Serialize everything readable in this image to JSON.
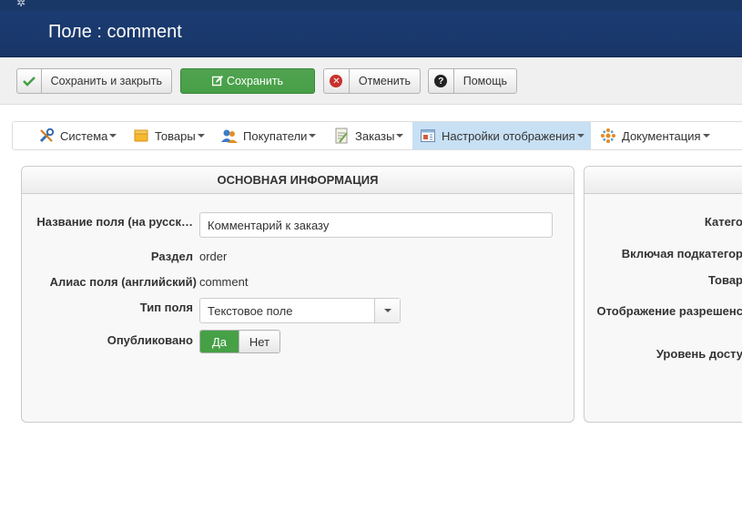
{
  "header": {
    "title": "Поле : comment"
  },
  "toolbar": {
    "save_close": "Сохранить и закрыть",
    "save": "Сохранить",
    "cancel": "Отменить",
    "help": "Помощь"
  },
  "menu": {
    "items": [
      {
        "label": "Система",
        "icon": "tools-icon"
      },
      {
        "label": "Товары",
        "icon": "box-icon"
      },
      {
        "label": "Покупатели",
        "icon": "users-icon"
      },
      {
        "label": "Заказы",
        "icon": "orders-icon"
      },
      {
        "label": "Настройки отображения",
        "icon": "display-settings-icon",
        "active": true
      },
      {
        "label": "Документация",
        "icon": "documentation-icon"
      }
    ]
  },
  "main_panel": {
    "title": "ОСНОВНАЯ ИНФОРМАЦИЯ",
    "field_name_label": "Название поля (на русск…",
    "field_name_value": "Комментарий к заказу",
    "section_label": "Раздел",
    "section_value": "order",
    "alias_label": "Алиас поля (английский)",
    "alias_value": "comment",
    "type_label": "Тип поля",
    "type_value": "Текстовое поле",
    "published_label": "Опубликовано",
    "published_yes": "Да",
    "published_no": "Нет",
    "published_value": "Да"
  },
  "side_panel": {
    "category_label": "Катего",
    "include_sub_label": "Включая подкатегор",
    "products_label": "Товар",
    "display_allowed_label": "Отображение разрешенс",
    "access_level_label": "Уровень досту"
  },
  "colors": {
    "header_bg": "#1b3c73",
    "save_green": "#46a046",
    "cancel_red": "#c9302c",
    "active_menu": "#c7e0f4"
  }
}
